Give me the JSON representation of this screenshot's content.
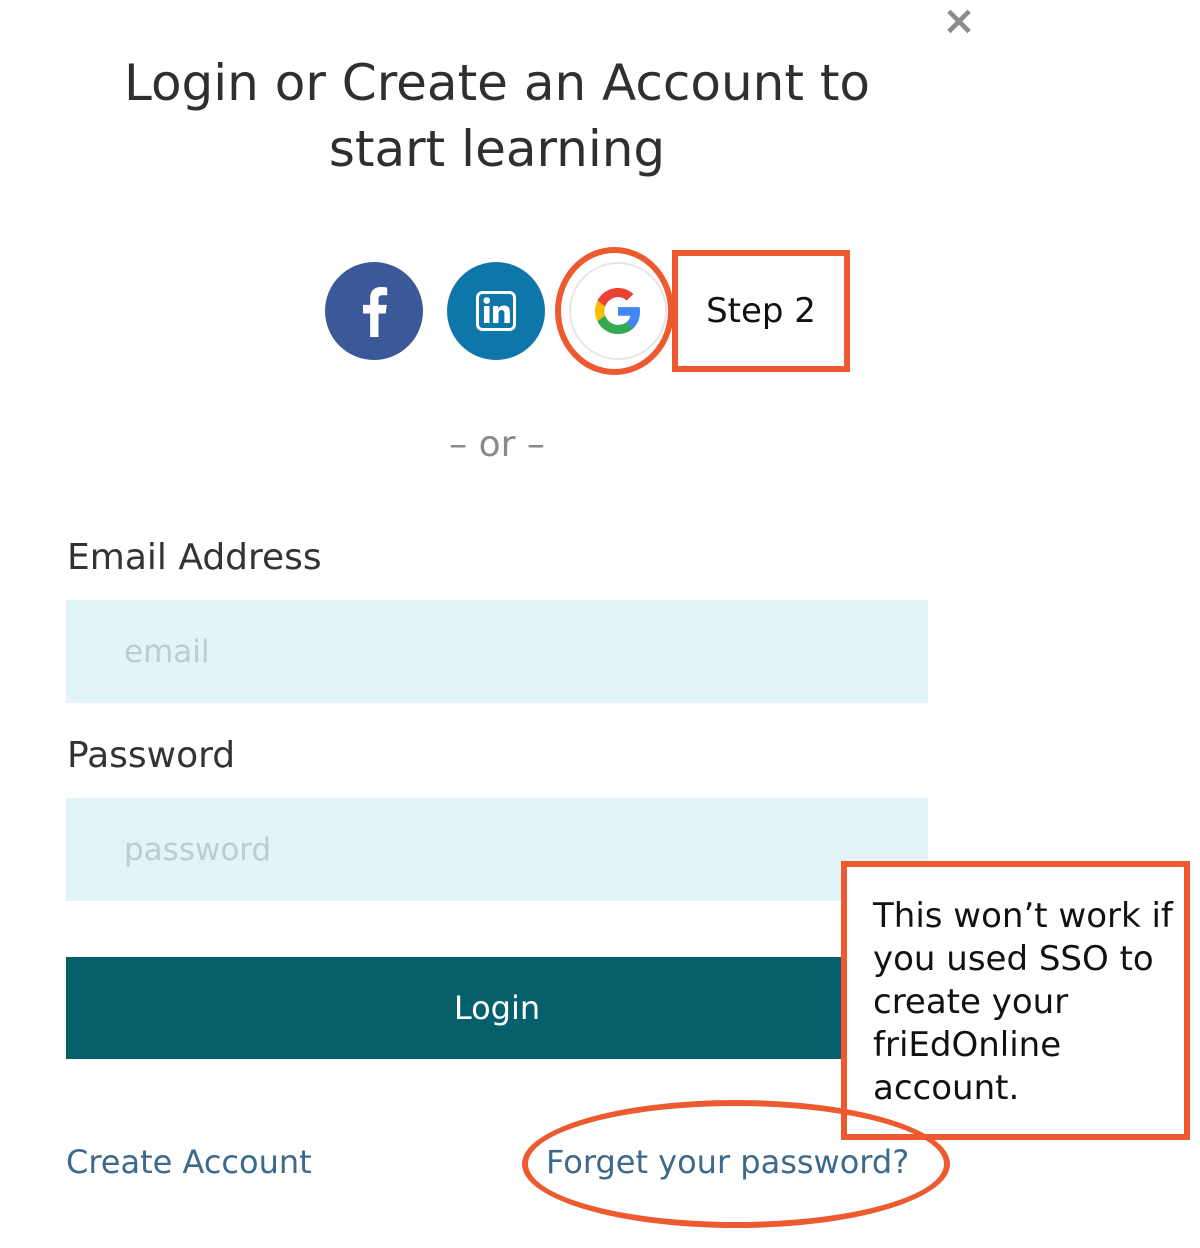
{
  "modal": {
    "close_glyph": "×",
    "title": "Login or Create an Account to start learning"
  },
  "social": {
    "facebook_icon": "facebook-icon",
    "linkedin_icon": "linkedin-icon",
    "google_icon": "google-icon",
    "facebook_color": "#3b5998",
    "linkedin_color": "#0e76a8"
  },
  "separator": "– or –",
  "form": {
    "email_label": "Email Address",
    "email_placeholder": "email",
    "email_value": "",
    "password_label": "Password",
    "password_placeholder": "password",
    "password_value": "",
    "login_label": "Login",
    "login_color": "#05606c"
  },
  "links": {
    "create_account": "Create Account",
    "forgot_password": "Forget your password?"
  },
  "annotations": {
    "step_label": "Step 2",
    "note": "This won’t work if you used SSO to create your friEdOnline account.",
    "color": "#ee5a2f"
  }
}
